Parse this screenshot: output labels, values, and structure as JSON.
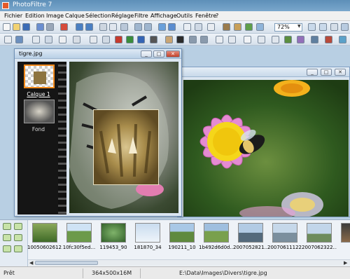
{
  "app": {
    "title": "PhotoFiltre 7"
  },
  "menu": [
    "Fichier",
    "Edition",
    "Image",
    "Calque",
    "Sélection",
    "Réglage",
    "Filtre",
    "Affichage",
    "Outils",
    "Fenêtre",
    "?"
  ],
  "toolbar": {
    "zoom": "72%"
  },
  "front_window": {
    "title": "tigre.jpg",
    "layers": [
      "Calque 1",
      "Fond"
    ]
  },
  "browser": {
    "thumbnails": [
      "10050602612...",
      "10fc30f5ed...",
      "119453_90",
      "181870_34",
      "190211_10",
      "1b492d6d0d...",
      "2007052821...",
      "20070611122...",
      "2007062322...",
      ""
    ]
  },
  "status": {
    "state": "Prêt",
    "dimensions": "364x500x16M",
    "path": "E:\\Data\\Images\\Divers\\tigre.jpg"
  },
  "colors": {
    "accent_selection": "#f28a1c",
    "titlebar": "#6a9ac1"
  }
}
